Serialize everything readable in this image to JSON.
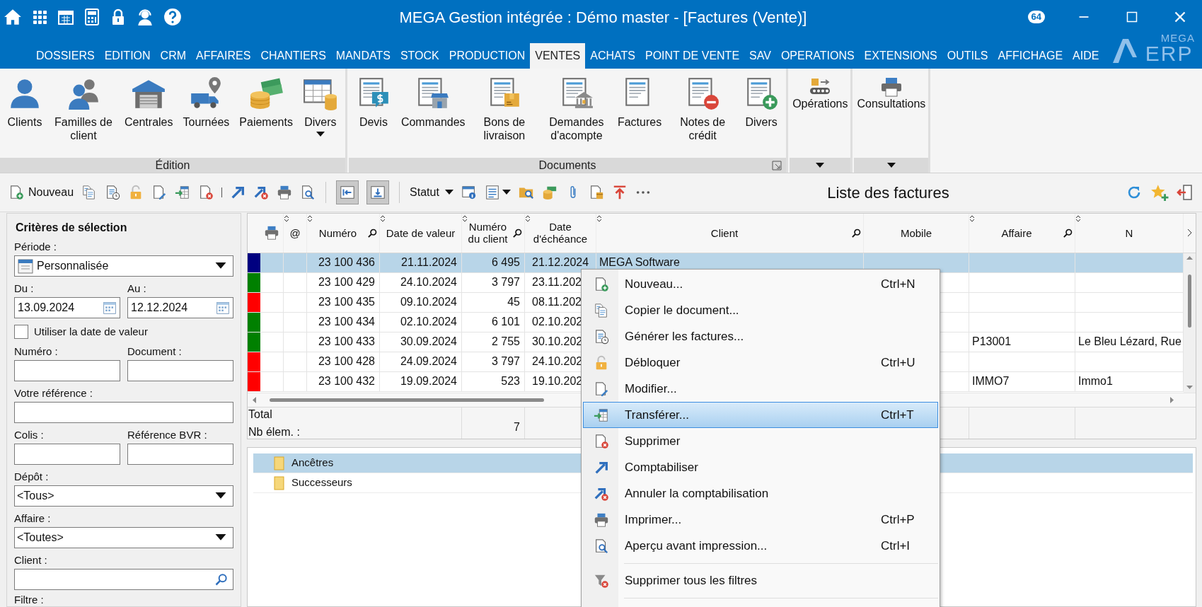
{
  "window": {
    "title": "MEGA Gestion intégrée : Démo master - [Factures (Vente)]",
    "badge": "64",
    "logo_top": "MEGA",
    "logo_bottom": "ERP"
  },
  "menu": [
    {
      "label": "DOSSIERS",
      "selected": false
    },
    {
      "label": "EDITION",
      "selected": false
    },
    {
      "label": "CRM",
      "selected": false
    },
    {
      "label": "AFFAIRES",
      "selected": false
    },
    {
      "label": "CHANTIERS",
      "selected": false
    },
    {
      "label": "MANDATS",
      "selected": false
    },
    {
      "label": "STOCK",
      "selected": false
    },
    {
      "label": "PRODUCTION",
      "selected": false
    },
    {
      "label": "VENTES",
      "selected": true
    },
    {
      "label": "ACHATS",
      "selected": false
    },
    {
      "label": "POINT DE VENTE",
      "selected": false
    },
    {
      "label": "SAV",
      "selected": false
    },
    {
      "label": "OPERATIONS",
      "selected": false
    },
    {
      "label": "EXTENSIONS",
      "selected": false
    },
    {
      "label": "OUTILS",
      "selected": false
    },
    {
      "label": "AFFICHAGE",
      "selected": false
    },
    {
      "label": "AIDE",
      "selected": false
    }
  ],
  "ribbon": [
    {
      "kind": "large",
      "label": "Édition",
      "launcher": false,
      "buttons": [
        {
          "label": "Clients"
        },
        {
          "label": "Familles de client"
        },
        {
          "label": "Centrales"
        },
        {
          "label": "Tournées"
        },
        {
          "label": "Paiements"
        },
        {
          "label": "Divers",
          "dropdown": true
        }
      ]
    },
    {
      "kind": "large",
      "label": "Documents",
      "launcher": true,
      "buttons": [
        {
          "label": "Devis"
        },
        {
          "label": "Commandes"
        },
        {
          "label": "Bons de livraison"
        },
        {
          "label": "Demandes d'acompte"
        },
        {
          "label": "Factures"
        },
        {
          "label": "Notes de crédit"
        },
        {
          "label": "Divers"
        }
      ]
    },
    {
      "kind": "compact",
      "dropdown": true,
      "buttons": [
        {
          "label": "Opérations"
        }
      ]
    },
    {
      "kind": "compact",
      "dropdown": true,
      "buttons": [
        {
          "label": "Consultations"
        }
      ]
    }
  ],
  "toolbar": {
    "new_label": "Nouveau",
    "toggles": [
      {
        "selected": true
      },
      {
        "selected": true
      }
    ],
    "status_label": "Statut",
    "title": "Liste des factures"
  },
  "filters": {
    "title": "Critères de sélection",
    "rows": [
      {
        "kind": "select",
        "label": "Période :",
        "value": "Personnalisée"
      },
      {
        "kind": "pair",
        "fields": [
          {
            "kind": "date",
            "label": "Du :",
            "value": "13.09.2024"
          },
          {
            "kind": "date",
            "label": "Au :",
            "value": "12.12.2024"
          }
        ]
      },
      {
        "kind": "checkbox",
        "label": "Utiliser la date de valeur",
        "checked": false
      },
      {
        "kind": "pair",
        "fields": [
          {
            "kind": "text",
            "label": "Numéro :"
          },
          {
            "kind": "text",
            "label": "Document :"
          }
        ]
      },
      {
        "kind": "text",
        "label": "Votre référence :"
      },
      {
        "kind": "pair",
        "fields": [
          {
            "kind": "text",
            "label": "Colis :"
          },
          {
            "kind": "text",
            "label": "Référence BVR :"
          }
        ]
      },
      {
        "kind": "select",
        "label": "Dépôt :",
        "value": "<Tous>"
      },
      {
        "kind": "select",
        "label": "Affaire :",
        "value": "<Toutes>"
      },
      {
        "kind": "search",
        "label": "Client :"
      },
      {
        "kind": "label",
        "label": "Filtre :"
      }
    ]
  },
  "table": {
    "columns": [
      {
        "kind": "icon",
        "sortable": false
      },
      {
        "kind": "text",
        "label": "@",
        "sortable": true
      },
      {
        "kind": "text",
        "label": "Numéro",
        "search": true,
        "sortable": true
      },
      {
        "kind": "text",
        "label": "Date de valeur",
        "sortable": true
      },
      {
        "kind": "text",
        "label": "Numéro du client",
        "search": true,
        "sortable": true
      },
      {
        "kind": "text",
        "label": "Date d'échéance",
        "sortable": true
      },
      {
        "kind": "text",
        "label": "Client",
        "search": true,
        "sortable": true
      },
      {
        "kind": "text",
        "label": "Mobile",
        "sortable": false
      },
      {
        "kind": "text",
        "label": "Affaire",
        "search": true,
        "sortable": true
      },
      {
        "kind": "text",
        "label": "N",
        "sortable": true
      }
    ],
    "rows": [
      {
        "color": "#000080",
        "selected": true,
        "numero": "23 100 436",
        "date_valeur": "21.11.2024",
        "numero_client": "6 495",
        "echeance": "21.12.2024",
        "client": "MEGA Software"
      },
      {
        "color": "#008000",
        "selected": false,
        "numero": "23 100 429",
        "date_valeur": "24.10.2024",
        "numero_client": "3 797",
        "echeance": "23.11.202"
      },
      {
        "color": "#ff0000",
        "selected": false,
        "numero": "23 100 435",
        "date_valeur": "09.10.2024",
        "numero_client": "45",
        "echeance": "08.11.202"
      },
      {
        "color": "#008000",
        "selected": false,
        "numero": "23 100 434",
        "date_valeur": "02.10.2024",
        "numero_client": "6 101",
        "echeance": "02.10.202"
      },
      {
        "color": "#008000",
        "selected": false,
        "numero": "23 100 433",
        "date_valeur": "30.09.2024",
        "numero_client": "2 755",
        "echeance": "30.10.202",
        "affaire": "P13001",
        "column_10": "Le Bleu Lézard, Rue"
      },
      {
        "color": "#ff0000",
        "selected": false,
        "numero": "23 100 428",
        "date_valeur": "24.09.2024",
        "numero_client": "3 797",
        "echeance": "24.10.202"
      },
      {
        "color": "#ff0000",
        "selected": false,
        "numero": "23 100 432",
        "date_valeur": "19.09.2024",
        "numero_client": "523",
        "echeance": "19.10.202",
        "affaire": "IMMO7",
        "column_10": "Immo1"
      }
    ],
    "totals": {
      "total_label": "Total",
      "count_label": "Nb élem. :",
      "count": "7"
    }
  },
  "tree": [
    {
      "label": "Ancêtres",
      "selected": true
    },
    {
      "label": "Successeurs",
      "selected": false
    }
  ],
  "context_menu": [
    {
      "kind": "item",
      "label": "Nouveau...",
      "shortcut": "Ctrl+N",
      "selected": false
    },
    {
      "kind": "item",
      "label": "Copier le document...",
      "selected": false
    },
    {
      "kind": "item",
      "label": "Générer les factures...",
      "selected": false
    },
    {
      "kind": "item",
      "label": "Débloquer",
      "shortcut": "Ctrl+U",
      "selected": false
    },
    {
      "kind": "item",
      "label": "Modifier...",
      "selected": false
    },
    {
      "kind": "item",
      "label": "Transférer...",
      "shortcut": "Ctrl+T",
      "selected": true
    },
    {
      "kind": "item",
      "label": "Supprimer",
      "selected": false
    },
    {
      "kind": "item",
      "label": "Comptabiliser",
      "selected": false
    },
    {
      "kind": "item",
      "label": "Annuler la comptabilisation",
      "selected": false
    },
    {
      "kind": "item",
      "label": "Imprimer...",
      "shortcut": "Ctrl+P",
      "selected": false
    },
    {
      "kind": "item",
      "label": "Aperçu avant impression...",
      "shortcut": "Ctrl+I",
      "selected": false
    },
    {
      "kind": "separator"
    },
    {
      "kind": "item",
      "label": "Supprimer tous les filtres",
      "selected": false
    },
    {
      "kind": "separator"
    }
  ]
}
